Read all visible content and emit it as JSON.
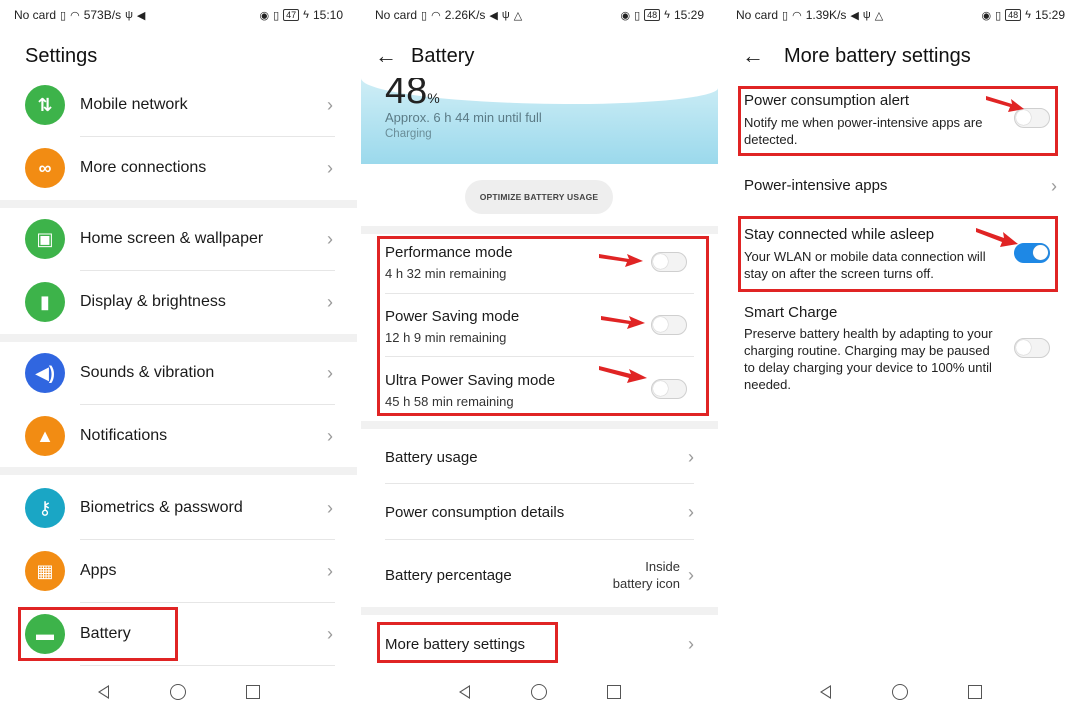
{
  "panels": [
    {
      "status": {
        "carrier": "No card",
        "speed": "573B/s",
        "battery": "47",
        "time": "15:10"
      },
      "title": "Settings",
      "items": [
        {
          "label": "Mobile network",
          "icon": "mobile-data-icon",
          "color": "#3db34a"
        },
        {
          "label": "More connections",
          "icon": "link-icon",
          "color": "#f28c13"
        },
        {
          "label": "Home screen & wallpaper",
          "icon": "image-icon",
          "color": "#3db34a"
        },
        {
          "label": "Display & brightness",
          "icon": "phone-brightness-icon",
          "color": "#3db34a"
        },
        {
          "label": "Sounds & vibration",
          "icon": "speaker-icon",
          "color": "#3066e0"
        },
        {
          "label": "Notifications",
          "icon": "bell-icon",
          "color": "#f28c13"
        },
        {
          "label": "Biometrics & password",
          "icon": "key-icon",
          "color": "#1aa6c5"
        },
        {
          "label": "Apps",
          "icon": "grid-icon",
          "color": "#f28c13"
        },
        {
          "label": "Battery",
          "icon": "battery-icon",
          "color": "#3db34a"
        }
      ]
    },
    {
      "status": {
        "carrier": "No card",
        "speed": "2.26K/s",
        "battery": "48",
        "time": "15:29"
      },
      "title": "Battery",
      "percent": "48",
      "percent_sign": "%",
      "approx": "Approx. 6 h 44 min until full",
      "charging": "Charging",
      "optimize": "OPTIMIZE BATTERY USAGE",
      "modes": [
        {
          "title": "Performance mode",
          "sub": "4 h 32 min remaining",
          "on": false
        },
        {
          "title": "Power Saving mode",
          "sub": "12 h 9 min remaining",
          "on": false
        },
        {
          "title": "Ultra Power Saving mode",
          "sub": "45 h 58 min remaining",
          "on": false
        }
      ],
      "items": [
        {
          "label": "Battery usage"
        },
        {
          "label": "Power consumption details"
        },
        {
          "label": "Battery percentage",
          "value_line1": "Inside",
          "value_line2": "battery icon"
        },
        {
          "label": "More battery settings"
        }
      ]
    },
    {
      "status": {
        "carrier": "No card",
        "speed": "1.39K/s",
        "battery": "48",
        "time": "15:29"
      },
      "title": "More battery settings",
      "items": [
        {
          "title": "Power consumption alert",
          "sub": "Notify me when power-intensive apps are detected.",
          "on": false
        },
        {
          "title": "Power-intensive apps"
        },
        {
          "title": "Stay connected while asleep",
          "sub": "Your WLAN or mobile data connection will stay on after the screen turns off.",
          "on": true
        },
        {
          "title": "Smart Charge",
          "sub": "Preserve battery health by adapting to your charging routine. Charging may be paused to delay charging your device to 100% until needed.",
          "on": false
        }
      ]
    }
  ],
  "colors": {
    "highlight_red": "#e02424",
    "toggle_on": "#1e88e5"
  }
}
